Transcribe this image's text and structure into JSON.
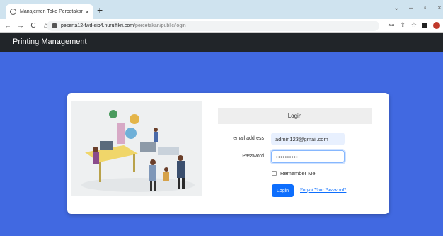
{
  "browser": {
    "tab_title": "Manajemen Toko Percetakan",
    "tab_close": "×",
    "new_tab": "+",
    "url_host": "peserta12-fwd-sib4.nurulfikri.com",
    "url_path": "/percetakan/public/login",
    "window_controls": {
      "collapse": "⌄",
      "minimize": "–",
      "restore": "▫",
      "close": "×"
    },
    "nav": {
      "back": "←",
      "forward": "→",
      "reload": "C",
      "home": "⌂"
    },
    "right_icons": {
      "key": "⊶",
      "share": "⇪",
      "star": "☆"
    }
  },
  "app": {
    "brand": "Printing Management"
  },
  "login": {
    "heading": "Login",
    "email_label": "email address",
    "email_value": "admin123@gmail.com",
    "password_label": "Password",
    "password_value": "••••••••••",
    "remember_label": "Remember Me",
    "login_button": "Login",
    "forgot_link": "Forgot Your Password?"
  }
}
